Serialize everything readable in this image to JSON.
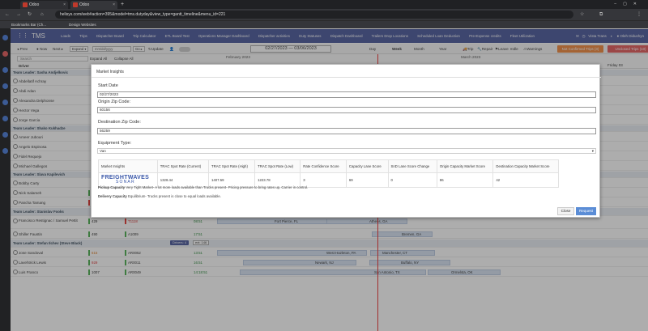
{
  "browser": {
    "tabs": [
      {
        "label": "Odoo"
      },
      {
        "label": "Odoo"
      }
    ],
    "url": "helisys.com/web#action=395&model=tms.dutyday&view_type=gantt_timeline&menu_id=221",
    "bookmarks": [
      "Bookmarks Bar (Ch...",
      "Design Websites"
    ]
  },
  "app": {
    "brand": "TMS",
    "menu": [
      "Loads",
      "Trips",
      "Dispatcher Board",
      "Trip Calculator",
      "ETL Board Test",
      "Operations Manager Dashboard",
      "Dispatcher activities",
      "Duty Statuses",
      "Dispatch Dashboard",
      "Trailers Drop Locations",
      "Scheduled Loan Deduction",
      "Pre-Expense credits",
      "Fleet Utilization"
    ],
    "company": "Vista Trans",
    "user": "Oleh Didushyn"
  },
  "toolbar": {
    "prev": "Prev",
    "now": "Now",
    "next": "Next",
    "expand": "Expand",
    "date_placeholder": "mm/dd/yyyy",
    "go": "Go",
    "update": "Update",
    "range": "02/27/2023 — 03/06/2023",
    "views": [
      "Day",
      "Week",
      "Month",
      "Year"
    ],
    "actions": [
      "Trip",
      "Repair",
      "Leave",
      "Idle",
      "Warnings"
    ],
    "not_confirmed": "Not Confirmed Trips (3)",
    "unclosed": "Unclosed Trips (10)"
  },
  "grid": {
    "search_placeholder": "Search",
    "expand_all": "Expand All",
    "collapse_all": "Collapse All",
    "col_driver": "Driver",
    "month_feb": "February 2023",
    "month_mar": "March 2023",
    "day_fri": "Friday 03"
  },
  "rows": [
    {
      "type": "leader",
      "name": "Team Leader: Sasha Andjelkovic"
    },
    {
      "type": "driver",
      "name": "Abdellatif Achray"
    },
    {
      "type": "driver",
      "name": "Abdi Adan"
    },
    {
      "type": "driver",
      "name": "Alexandra Delphonse"
    },
    {
      "type": "driver",
      "name": "Hector Vega"
    },
    {
      "type": "driver",
      "name": "Jorge Garcia"
    },
    {
      "type": "leader",
      "name": "Team Leader: Shako Kukhadze"
    },
    {
      "type": "driver",
      "name": "Ameer Jubouri"
    },
    {
      "type": "driver",
      "name": "Angelo Espinosa"
    },
    {
      "type": "driver",
      "name": "Fidel Requejo"
    },
    {
      "type": "driver",
      "name": "Michael Gallegos"
    },
    {
      "type": "leader",
      "name": "Team Leader: Slava Kapilevich"
    },
    {
      "type": "driver",
      "name": "Bobby Carty"
    },
    {
      "type": "driver",
      "name": "Nick Salameh",
      "unit": "1786",
      "truck": "A1185",
      "time": "01:08",
      "bar_to": "Spruce, MI"
    },
    {
      "type": "driver",
      "name": "Pancha Tamang",
      "unit": "264",
      "truck": "A1014"
    },
    {
      "type": "leader",
      "name": "Team Leader: Stanislav Fooks",
      "drivers": "Drivers: 2",
      "ext": "ext: 149"
    },
    {
      "type": "driver",
      "name": "Francisco Restignac / Samuel Pettit",
      "unit": "429",
      "truck": "T1118",
      "time": "08:51",
      "bar_from": "Fort Pierce, FL",
      "bar_to": "Athens, GA"
    },
    {
      "type": "driver",
      "name": "Shiller Faustin",
      "unit": "490",
      "truck": "A1009",
      "time": "17:51",
      "bar_to": "Bremen, GA"
    },
    {
      "type": "leader",
      "name": "Team Leader: Stefan Ilchev (Steve Black)",
      "drivers": "Drivers: 4",
      "ext": "ext: 146"
    },
    {
      "type": "driver",
      "name": "Jose Sandoval",
      "unit": "615",
      "truck": "AR0052",
      "time": "13:51",
      "bar_from": "West Hazleton, PA",
      "bar_to": "Manchester, CT"
    },
    {
      "type": "driver",
      "name": "Lavehtrick Lewis",
      "unit": "929",
      "truck": "AR0011",
      "time": "16:51",
      "bar_from": "Newark, NJ",
      "bar_to": "Buffalo, NY"
    },
    {
      "type": "driver",
      "name": "Luis Franco",
      "unit": "1007",
      "truck": "AR0049",
      "time": "14:18:51",
      "bar_from": "San Antonio, TX",
      "bar_to": "Ormelsta, OK"
    }
  ],
  "modal": {
    "title": "Market Insights",
    "start_date_label": "Start Date",
    "start_date": "02/27/2023",
    "origin_label": "Origin Zip Code:",
    "origin": "60156",
    "dest_label": "Destination Zip Code:",
    "dest": "56259",
    "equip_label": "Equipment Type:",
    "equip": "Van",
    "table": {
      "headers": [
        "Market Insights",
        "TRAC Spot Rate (Current)",
        "TRAC Spot Rate (High)",
        "TRAC Spot Rate (Low)",
        "Rate Confidence Score",
        "Capacity Lane Score",
        "SnD Lane Score Change",
        "Origin Capacity Market Score",
        "Destination Capacity Market Score"
      ],
      "logo_top": "FREIGHTWAVES",
      "logo_bottom": "SONAR",
      "values": [
        "1328.44",
        "1407.59",
        "1223.78",
        "3",
        "69",
        "0",
        "86",
        "42"
      ]
    },
    "pickup_label": "Pickup Capacity",
    "pickup_text": "Very Tight Market- A lot more loads available than Trucks present- Pricing pressure to bring rates up, Carrier in control.",
    "delivery_label": "Delivery Capacity",
    "delivery_text": "Equilibrium- Trucks present is close to equal loads available.",
    "close": "Close",
    "request": "Request"
  }
}
